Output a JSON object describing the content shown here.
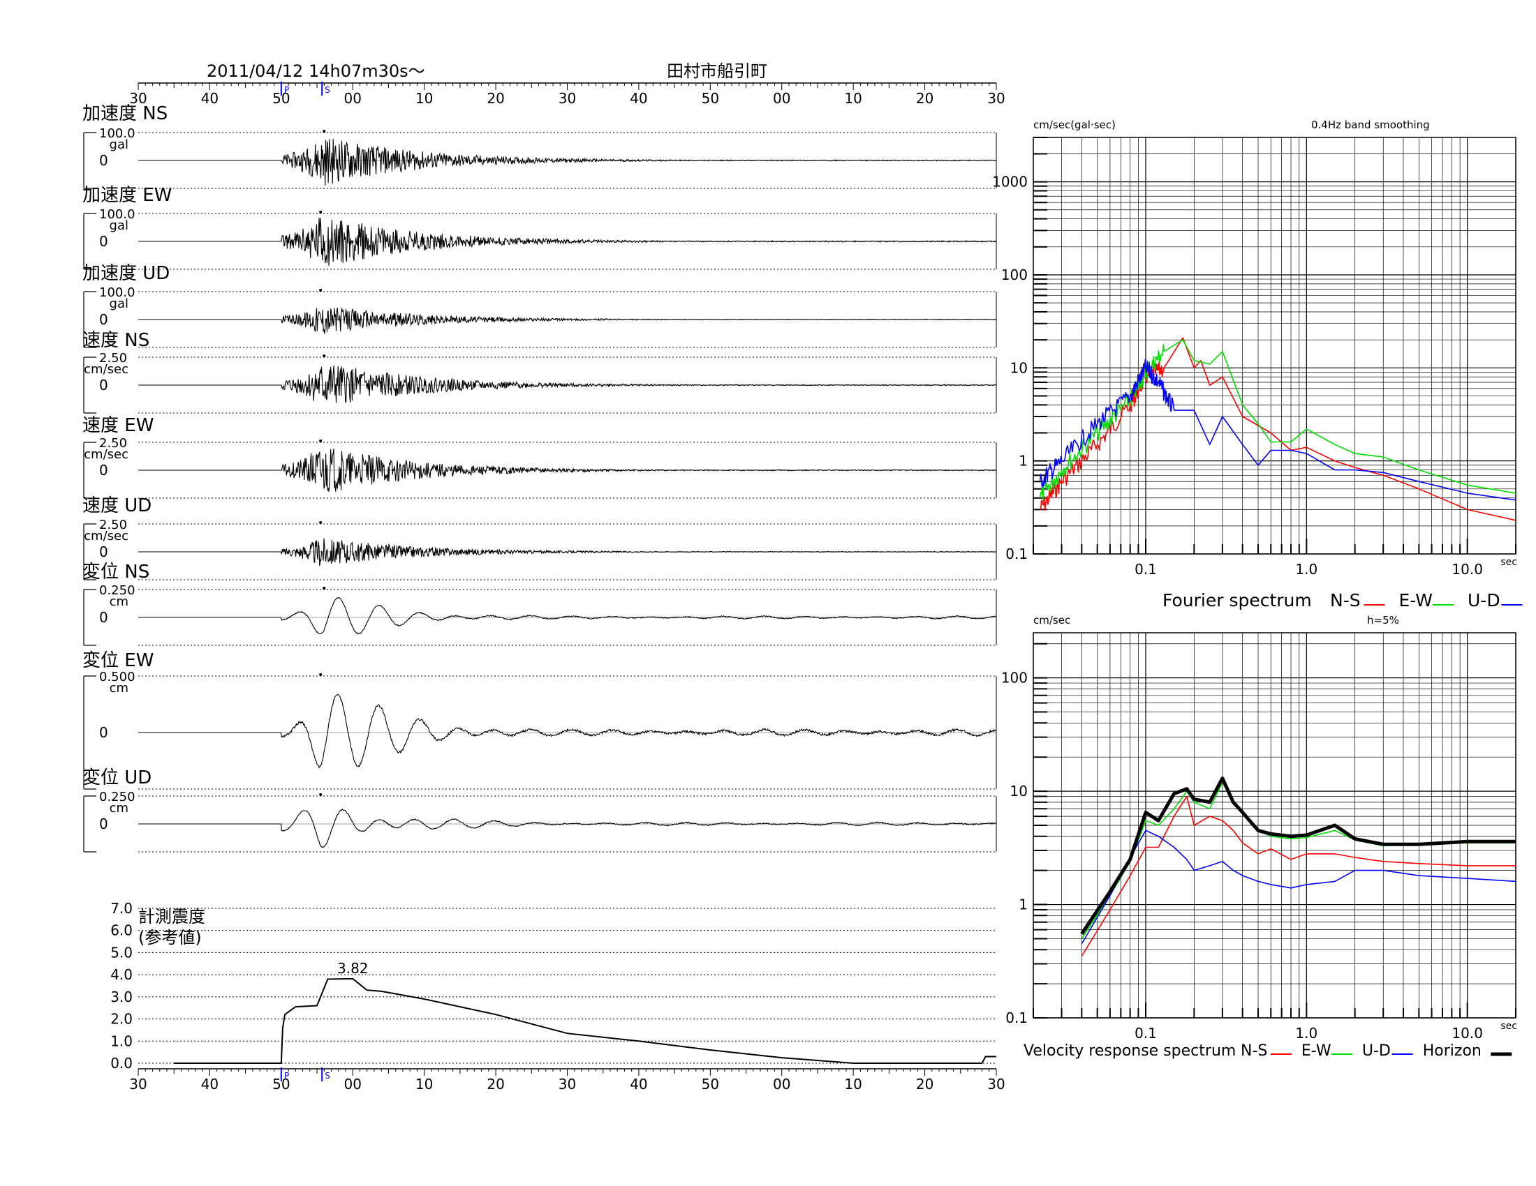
{
  "header": {
    "datetime": "2011/04/12  14h07m30s～",
    "station": "田村市船引町"
  },
  "time_axis": {
    "ticks": [
      "30",
      "40",
      "50",
      "00",
      "10",
      "20",
      "30",
      "40",
      "50",
      "00",
      "10",
      "20",
      "30"
    ],
    "p_marker": "P",
    "s_marker": "S",
    "p_index": 2,
    "s_index": 2.57
  },
  "traces": [
    {
      "label": "加速度 NS",
      "scale": "100.0",
      "unit": "gal",
      "zero": "0",
      "amp": 0.92,
      "type": "acc",
      "pk": 2.6,
      "seed": 11
    },
    {
      "label": "加速度 EW",
      "scale": "100.0",
      "unit": "gal",
      "zero": "0",
      "amp": 1.0,
      "type": "acc",
      "pk": 2.55,
      "seed": 23
    },
    {
      "label": "加速度 UD",
      "scale": "100.0",
      "unit": "gal",
      "zero": "0",
      "amp": 0.55,
      "type": "acc",
      "pk": 2.55,
      "seed": 37
    },
    {
      "label": "速度 NS",
      "scale": "2.50",
      "unit": "cm/sec",
      "zero": "0",
      "amp": 0.95,
      "type": "vel",
      "pk": 2.6,
      "seed": 41
    },
    {
      "label": "速度 EW",
      "scale": "2.50",
      "unit": "cm/sec",
      "zero": "0",
      "amp": 1.0,
      "type": "vel",
      "pk": 2.55,
      "seed": 53
    },
    {
      "label": "速度 UD",
      "scale": "2.50",
      "unit": "cm/sec",
      "zero": "0",
      "amp": 0.6,
      "type": "vel",
      "pk": 2.55,
      "seed": 67
    },
    {
      "label": "変位 NS",
      "scale": "0.250",
      "unit": "cm",
      "zero": "0",
      "amp": 0.9,
      "type": "disp",
      "pk": 2.6,
      "seed": 71
    },
    {
      "label": "変位 EW",
      "scale": "0.500",
      "unit": "cm",
      "zero": "0",
      "amp": 1.0,
      "type": "disp",
      "pk": 2.55,
      "seed": 83
    },
    {
      "label": "変位 UD",
      "scale": "0.250",
      "unit": "cm",
      "zero": "0",
      "amp": 1.0,
      "type": "disp",
      "pk": 2.55,
      "seed": 97
    }
  ],
  "intensity": {
    "label_line1": "計測震度",
    "label_line2": "(参考値)",
    "yticks": [
      "7.0",
      "6.0",
      "5.0",
      "4.0",
      "3.0",
      "2.0",
      "1.0",
      "0.0"
    ],
    "peak_label": "3.82",
    "chart_data": {
      "type": "line",
      "xlabel": "",
      "ylabel": "計測震度",
      "ylim": [
        0,
        7
      ],
      "x_minutes_from_start": [
        0.5,
        2.0,
        2.02,
        2.05,
        2.2,
        2.5,
        2.65,
        3.0,
        3.2,
        3.4,
        4.0,
        5.0,
        6.0,
        7.0,
        8.0,
        9.0,
        10.0,
        10.5,
        11.8,
        11.85,
        12.0
      ],
      "values": [
        0.0,
        0.0,
        1.6,
        2.2,
        2.55,
        2.6,
        3.8,
        3.82,
        3.3,
        3.25,
        2.9,
        2.2,
        1.35,
        1.0,
        0.6,
        0.25,
        0.0,
        0.0,
        0.0,
        0.3,
        0.3
      ]
    }
  },
  "fourier": {
    "ylabel": "cm/sec(gal·sec)",
    "note": "0.4Hz band smoothing",
    "yticks": [
      "1000",
      "100",
      "10",
      "1",
      "0.1"
    ],
    "xticks": [
      "0.1",
      "1.0",
      "10.0"
    ],
    "xunit": "sec",
    "legend_title": "Fourier spectrum",
    "legend": [
      {
        "name": "N-S",
        "color": "#ff0000"
      },
      {
        "name": "E-W",
        "color": "#00dd00"
      },
      {
        "name": "U-D",
        "color": "#0000ff"
      }
    ],
    "chart_data": {
      "type": "line",
      "xlim": [
        0.02,
        20
      ],
      "ylim": [
        0.1,
        1000
      ],
      "log_x": true,
      "log_y": true,
      "series": [
        {
          "name": "N-S",
          "color": "#ff0000",
          "x": [
            0.022,
            0.03,
            0.05,
            0.08,
            0.1,
            0.13,
            0.17,
            0.2,
            0.22,
            0.25,
            0.3,
            0.4,
            0.6,
            0.8,
            1.0,
            1.5,
            2.0,
            3.0,
            5.0,
            10.0,
            20.0
          ],
          "values": [
            0.3,
            0.6,
            1.5,
            4.0,
            8.0,
            10.0,
            21.0,
            10.0,
            12.0,
            6.5,
            8.0,
            3.0,
            2.0,
            1.3,
            1.4,
            1.0,
            0.85,
            0.7,
            0.5,
            0.3,
            0.23
          ]
        },
        {
          "name": "E-W",
          "color": "#00dd00",
          "x": [
            0.022,
            0.03,
            0.05,
            0.08,
            0.1,
            0.13,
            0.17,
            0.2,
            0.25,
            0.3,
            0.4,
            0.5,
            0.6,
            0.8,
            1.0,
            1.5,
            2.0,
            3.0,
            5.0,
            10.0,
            20.0
          ],
          "values": [
            0.4,
            0.8,
            2.0,
            4.5,
            9.0,
            15.0,
            20.0,
            12.0,
            11.0,
            15.0,
            4.0,
            2.5,
            1.6,
            1.6,
            2.2,
            1.5,
            1.2,
            1.1,
            0.8,
            0.55,
            0.45
          ]
        },
        {
          "name": "U-D",
          "color": "#0000ff",
          "x": [
            0.022,
            0.03,
            0.05,
            0.08,
            0.1,
            0.12,
            0.15,
            0.2,
            0.25,
            0.3,
            0.4,
            0.5,
            0.6,
            0.8,
            1.0,
            1.5,
            2.0,
            3.0,
            5.0,
            10.0,
            20.0
          ],
          "values": [
            0.6,
            1.0,
            2.5,
            5.0,
            10.0,
            7.0,
            3.5,
            3.5,
            1.5,
            3.0,
            1.5,
            0.9,
            1.3,
            1.3,
            1.2,
            0.8,
            0.8,
            0.75,
            0.6,
            0.45,
            0.38
          ]
        }
      ]
    }
  },
  "response": {
    "ylabel": "cm/sec",
    "note": "h=5%",
    "yticks": [
      "100",
      "10",
      "1",
      "0.1"
    ],
    "xticks": [
      "0.1",
      "1.0",
      "10.0"
    ],
    "xunit": "sec",
    "legend_title": "Velocity response spectrum",
    "legend": [
      {
        "name": "N-S",
        "color": "#ff0000"
      },
      {
        "name": "E-W",
        "color": "#00dd00"
      },
      {
        "name": "U-D",
        "color": "#0000ff"
      },
      {
        "name": "Horizon",
        "color": "#000000"
      }
    ],
    "chart_data": {
      "type": "line",
      "xlim": [
        0.02,
        20
      ],
      "ylim": [
        0.1,
        200
      ],
      "log_x": true,
      "log_y": true,
      "series": [
        {
          "name": "N-S",
          "color": "#ff0000",
          "x": [
            0.04,
            0.06,
            0.08,
            0.1,
            0.12,
            0.15,
            0.18,
            0.2,
            0.25,
            0.3,
            0.35,
            0.4,
            0.5,
            0.6,
            0.8,
            1.0,
            1.5,
            2.0,
            3.0,
            5.0,
            10.0,
            20.0
          ],
          "values": [
            0.35,
            0.9,
            1.8,
            3.2,
            3.2,
            6.0,
            9.0,
            5.0,
            6.0,
            5.5,
            4.5,
            3.5,
            2.8,
            3.1,
            2.5,
            2.8,
            2.8,
            2.6,
            2.4,
            2.3,
            2.2,
            2.2
          ]
        },
        {
          "name": "E-W",
          "color": "#00dd00",
          "x": [
            0.04,
            0.06,
            0.08,
            0.1,
            0.12,
            0.15,
            0.18,
            0.2,
            0.25,
            0.3,
            0.35,
            0.4,
            0.5,
            0.6,
            0.8,
            1.0,
            1.5,
            2.0,
            3.0,
            5.0,
            10.0,
            20.0
          ],
          "values": [
            0.5,
            1.2,
            2.4,
            5.5,
            5.0,
            7.0,
            10.0,
            8.0,
            7.0,
            12.0,
            8.0,
            6.5,
            4.5,
            4.0,
            3.8,
            3.9,
            4.5,
            3.7,
            3.3,
            3.4,
            3.5,
            3.5
          ]
        },
        {
          "name": "U-D",
          "color": "#0000ff",
          "x": [
            0.04,
            0.06,
            0.08,
            0.1,
            0.12,
            0.15,
            0.18,
            0.2,
            0.25,
            0.3,
            0.35,
            0.4,
            0.5,
            0.6,
            0.8,
            1.0,
            1.5,
            2.0,
            3.0,
            5.0,
            10.0,
            20.0
          ],
          "values": [
            0.45,
            1.2,
            2.6,
            4.5,
            4.0,
            3.2,
            2.5,
            2.0,
            2.2,
            2.4,
            2.0,
            1.8,
            1.6,
            1.5,
            1.4,
            1.5,
            1.6,
            2.0,
            2.0,
            1.8,
            1.7,
            1.6
          ]
        },
        {
          "name": "Horizon",
          "color": "#000000",
          "x": [
            0.04,
            0.06,
            0.08,
            0.1,
            0.12,
            0.15,
            0.18,
            0.2,
            0.25,
            0.3,
            0.35,
            0.4,
            0.5,
            0.6,
            0.8,
            1.0,
            1.5,
            2.0,
            3.0,
            5.0,
            10.0,
            20.0
          ],
          "values": [
            0.55,
            1.3,
            2.5,
            6.5,
            5.5,
            9.5,
            10.5,
            8.5,
            8.0,
            13.0,
            8.0,
            6.5,
            4.5,
            4.2,
            4.0,
            4.1,
            5.0,
            3.8,
            3.4,
            3.4,
            3.6,
            3.6
          ]
        }
      ]
    }
  }
}
